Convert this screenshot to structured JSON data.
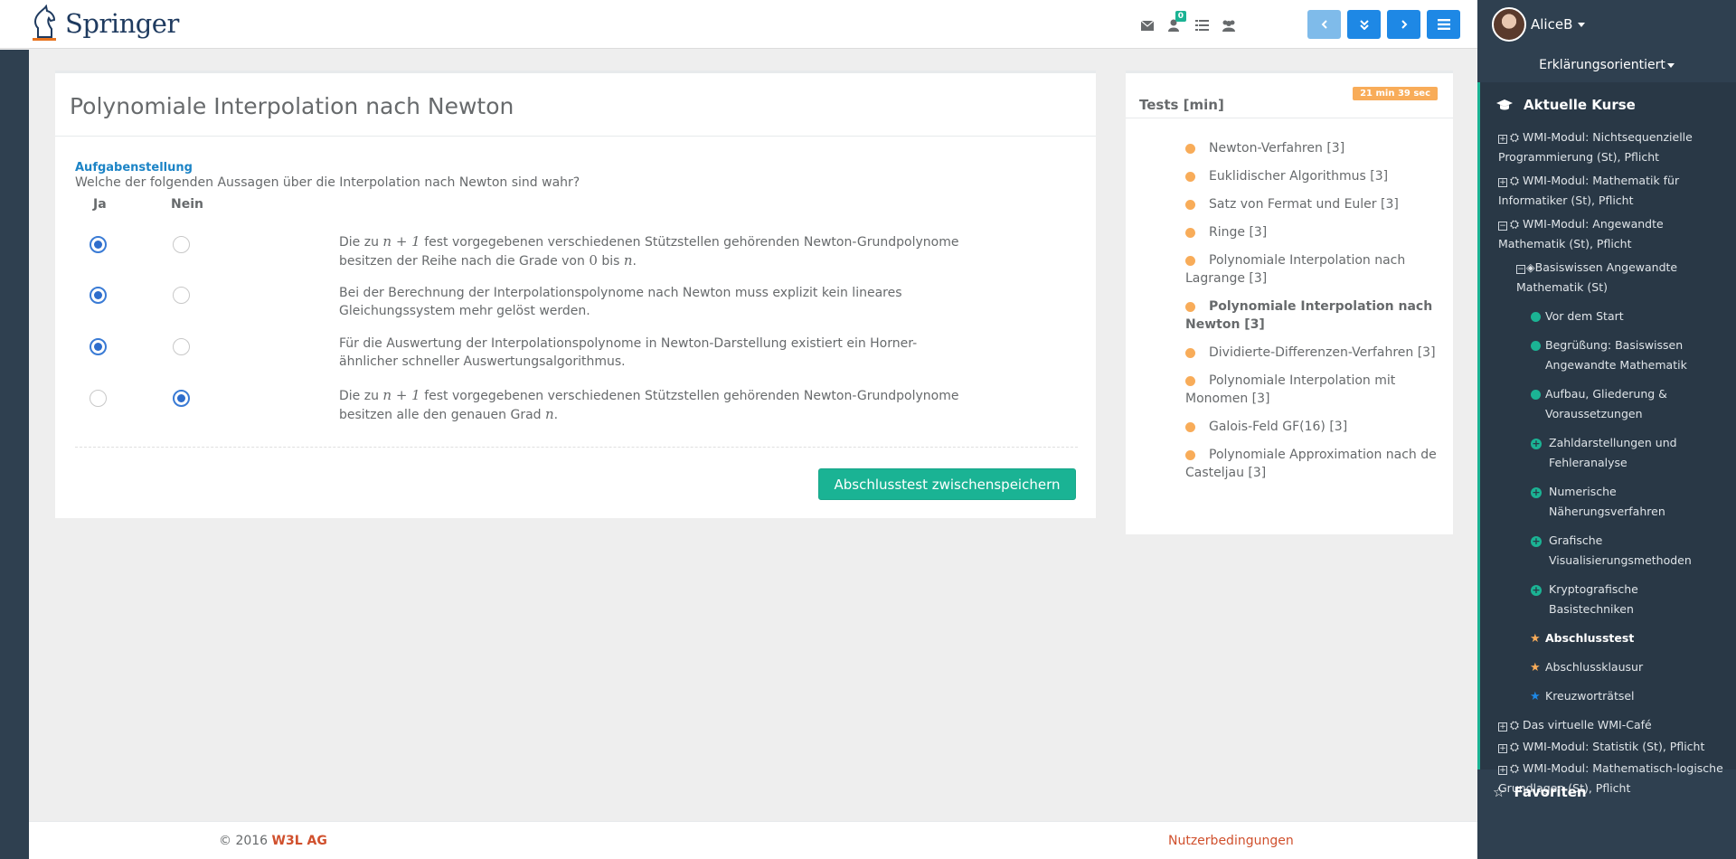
{
  "header": {
    "logo_text": "Springer",
    "notification_count": "0",
    "icons": [
      "envelope-icon",
      "user-badge-icon",
      "list-icon",
      "group-icon"
    ],
    "nav_buttons": [
      "prev-button",
      "expand-button",
      "next-button",
      "menu-button"
    ]
  },
  "sidebar": {
    "username": "AliceB",
    "mode": "Erklärungsorientiert",
    "courses_heading": "Aktuelle Kurse",
    "courses": [
      {
        "label": "WMI-Modul: Nichtsequenzielle Programmierung (St), Pflicht"
      },
      {
        "label": "WMI-Modul: Mathematik für Informatiker (St), Pflicht"
      },
      {
        "label": "WMI-Modul: Angewandte Mathematik (St), Pflicht"
      }
    ],
    "sub_course": "Basiswissen Angewandte Mathematik (St)",
    "chapters": [
      {
        "label": "Vor dem Start",
        "state": "done"
      },
      {
        "label": "Begrüßung: Basiswissen Angewandte Mathematik",
        "state": "done"
      },
      {
        "label": "Aufbau, Gliederung & Voraussetzungen",
        "state": "done"
      },
      {
        "label": "Zahldarstellungen und Fehleranalyse",
        "state": "open"
      },
      {
        "label": "Numerische Näherungsverfahren",
        "state": "open"
      },
      {
        "label": "Grafische Visualisierungsmethoden",
        "state": "open"
      },
      {
        "label": "Kryptografische Basistechniken",
        "state": "open"
      },
      {
        "label": "Abschlusstest",
        "state": "star-active"
      },
      {
        "label": "Abschlussklausur",
        "state": "star"
      },
      {
        "label": "Kreuzworträtsel",
        "state": "star-blue"
      }
    ],
    "more_courses": [
      {
        "label": "Das virtuelle WMI-Café"
      },
      {
        "label": "WMI-Modul: Statistik (St), Pflicht"
      },
      {
        "label": "WMI-Modul: Mathematisch-logische Grundlagen (St), Pflicht"
      }
    ],
    "favorites": "Favoriten"
  },
  "main": {
    "title": "Polynomiale Interpolation nach Newton",
    "task_label": "Aufgabenstellung",
    "question": "Welche der folgenden Aussagen über die Interpolation nach Newton sind wahr?",
    "col_yes": "Ja",
    "col_no": "Nein",
    "statements": [
      {
        "pre": "Die zu",
        "m1": "n + 1",
        "mid": "fest vorgegebenen verschiedenen Stützstellen gehörenden Newton-Grundpolynome besitzen der Reihe nach die Grade von",
        "m2": "0",
        "mid2": "bis",
        "m3": "n",
        "post": ".",
        "answer": "ja"
      },
      {
        "text": "Bei der Berechnung der Interpolationspolynome nach Newton muss explizit kein lineares Gleichungssystem mehr gelöst werden.",
        "answer": "ja"
      },
      {
        "text": "Für die Auswertung der Interpolationspolynome in Newton-Darstellung existiert ein Horner-ähnlicher schneller Auswertungsalgorithmus.",
        "answer": "ja"
      },
      {
        "pre": "Die zu",
        "m1": "n + 1",
        "mid": "fest vorgegebenen verschiedenen Stützstellen gehörenden Newton-Grundpolynome besitzen alle den genauen Grad",
        "m3": "n",
        "post": ".",
        "answer": "nein"
      }
    ],
    "save_button": "Abschlusstest zwischenspeichern"
  },
  "tests": {
    "title": "Tests [min]",
    "timer": "21 min 39 sec",
    "items": [
      {
        "label": "Newton-Verfahren [3]",
        "active": false
      },
      {
        "label": "Euklidischer Algorithmus [3]",
        "active": false
      },
      {
        "label": "Satz von Fermat und Euler [3]",
        "active": false
      },
      {
        "label": "Ringe [3]",
        "active": false
      },
      {
        "label": "Polynomiale Interpolation nach Lagrange [3]",
        "active": false
      },
      {
        "label": "Polynomiale Interpolation nach Newton [3]",
        "active": true
      },
      {
        "label": "Dividierte-Differenzen-Verfahren [3]",
        "active": false
      },
      {
        "label": "Polynomiale Interpolation mit Monomen [3]",
        "active": false
      },
      {
        "label": "Galois-Feld GF(16) [3]",
        "active": false
      },
      {
        "label": "Polynomiale Approximation nach de Casteljau [3]",
        "active": false
      }
    ]
  },
  "footer": {
    "copyright": "© 2016",
    "company": "W3L AG",
    "terms": "Nutzerbedingungen"
  },
  "colors": {
    "primary": "#1e88e5",
    "success": "#1ab394",
    "warning": "#f8ac59",
    "sidebar": "#2f4050",
    "link": "#d0502d"
  }
}
